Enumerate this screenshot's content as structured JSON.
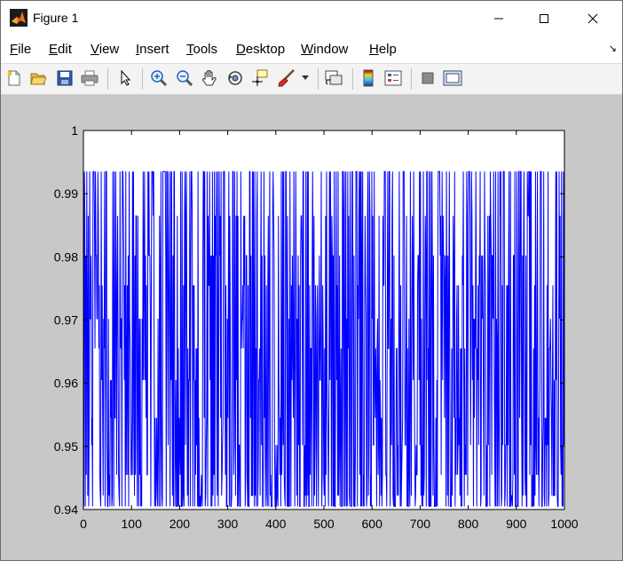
{
  "window": {
    "title": "Figure 1",
    "controls": {
      "minimize": "minimize",
      "maximize": "maximize",
      "close": "close"
    }
  },
  "menu": {
    "items": [
      {
        "mnemonic": "F",
        "rest": "ile"
      },
      {
        "mnemonic": "E",
        "rest": "dit"
      },
      {
        "mnemonic": "V",
        "rest": "iew"
      },
      {
        "mnemonic": "I",
        "rest": "nsert"
      },
      {
        "mnemonic": "T",
        "rest": "ools"
      },
      {
        "mnemonic": "D",
        "rest": "esktop"
      },
      {
        "mnemonic": "W",
        "rest": "indow"
      },
      {
        "mnemonic": "H",
        "rest": "elp"
      }
    ],
    "dock_arrow": "↘"
  },
  "toolbar": {
    "icons": [
      "new-figure-icon",
      "open-file-icon",
      "save-icon",
      "print-icon",
      "select-arrow-icon",
      "zoom-in-icon",
      "zoom-out-icon",
      "pan-hand-icon",
      "rotate-3d-icon",
      "data-cursor-icon",
      "brush-icon",
      "brush-dropdown-icon",
      "link-plot-icon",
      "colorbar-icon",
      "legend-icon",
      "hide-plot-tools-icon",
      "show-plot-tools-icon"
    ]
  },
  "colors": {
    "series": "#0000ff",
    "figure_bg": "#c8c8c8",
    "axes_bg": "#ffffff"
  },
  "chart_data": {
    "type": "line",
    "title": "",
    "xlabel": "",
    "ylabel": "",
    "xlim": [
      0,
      1000
    ],
    "ylim": [
      0.94,
      1.0
    ],
    "xticks": [
      0,
      100,
      200,
      300,
      400,
      500,
      600,
      700,
      800,
      900,
      1000
    ],
    "yticks": [
      0.94,
      0.95,
      0.96,
      0.97,
      0.98,
      0.99,
      1
    ],
    "ytick_labels": [
      "0.94",
      "0.95",
      "0.96",
      "0.97",
      "0.98",
      "0.99",
      "1"
    ],
    "grid": false,
    "series": [
      {
        "color": "#0000ff",
        "n_points": 1000,
        "min": 0.9405,
        "max": 0.9935,
        "levels": [
          0.9405,
          0.9422,
          0.9455,
          0.9502,
          0.9545,
          0.9605,
          0.9655,
          0.9702,
          0.9755,
          0.9802,
          0.9865,
          0.9935
        ],
        "description_values": [
          0.9935,
          0.9405,
          0.9935,
          0.9865,
          0.9405,
          0.9802,
          0.9455,
          0.9935,
          0.9702,
          0.9422
        ]
      }
    ]
  }
}
